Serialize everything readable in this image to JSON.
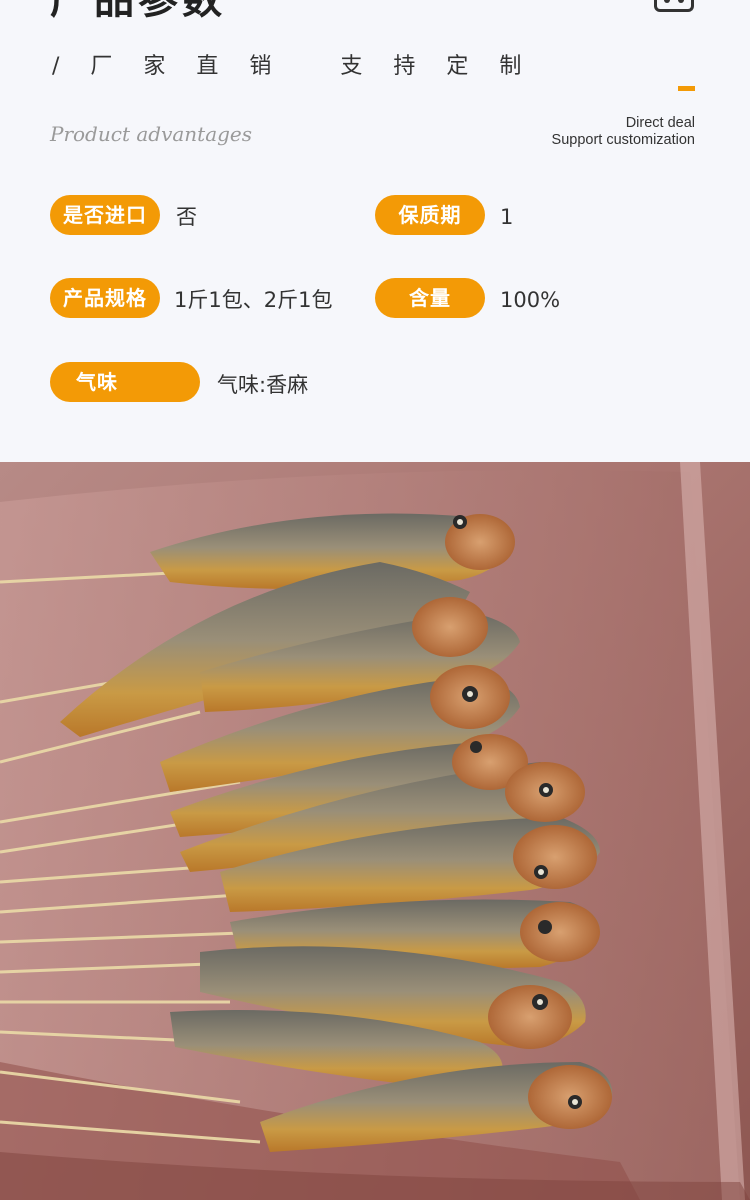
{
  "header": {
    "title": "产品参数",
    "subtitle": "/ 厂 家 直 销   支 持 定 制",
    "script_caption": "Product advantages",
    "note_line1": "Direct deal",
    "note_line2": "Support customization"
  },
  "params": [
    {
      "label": "是否进口",
      "value": "否"
    },
    {
      "label": "保质期",
      "value": "1"
    },
    {
      "label": "产品规格",
      "value": "1斤1包、2斤1包"
    },
    {
      "label": "含量",
      "value": "100%"
    },
    {
      "label": "气味",
      "value": "气味:香麻"
    }
  ],
  "colors": {
    "accent": "#f39a06",
    "background": "#f6f7fb",
    "text": "#333333"
  },
  "icons": {
    "corner": "scale-icon",
    "photo": "grilled-fish-skewers-image"
  }
}
